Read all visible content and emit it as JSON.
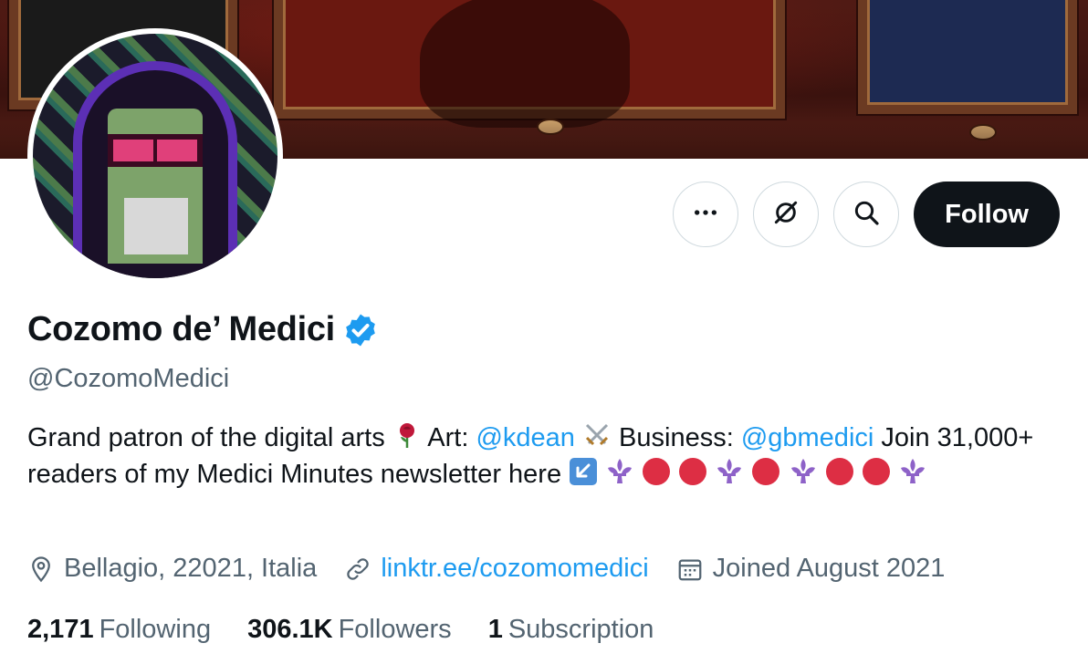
{
  "profile": {
    "display_name": "Cozomo de’ Medici",
    "handle": "@CozomoMedici",
    "verified_icon": "verified-badge-icon",
    "accent_color": "#1d9bf0"
  },
  "actions": {
    "more_icon": "more-horizontal-icon",
    "grok_icon": "grok-icon",
    "search_icon": "search-icon",
    "follow_label": "Follow"
  },
  "bio": {
    "part1": "Grand patron of the digital arts",
    "art_label": "Art:",
    "art_mention": "@kdean",
    "business_label": "Business:",
    "business_mention": "@gbmedici",
    "part2": "Join 31,000+ readers of my Medici Minutes newsletter here",
    "emojis": [
      "rose-emoji",
      "crossed-swords-emoji",
      "arrow-down-left-emoji",
      "fleur-de-lis-emoji",
      "red-circle-emoji"
    ]
  },
  "meta": {
    "location": "Bellagio, 22021, Italia",
    "link": "linktr.ee/cozomomedici",
    "joined": "Joined August 2021"
  },
  "stats": {
    "following_count": "2,171",
    "following_label": "Following",
    "followers_count": "306.1K",
    "followers_label": "Followers",
    "subscriptions_count": "1",
    "subscriptions_label": "Subscription"
  }
}
